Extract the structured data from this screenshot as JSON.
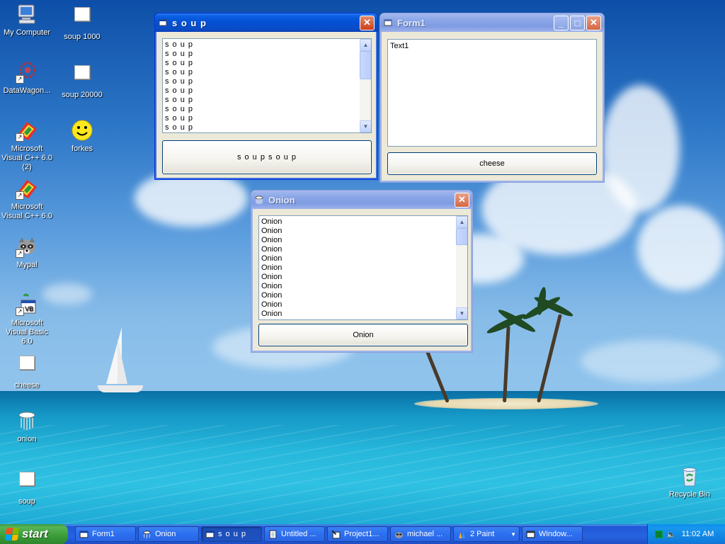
{
  "desktop": {
    "icons": [
      {
        "label": "My Computer",
        "icon": "my-computer-icon"
      },
      {
        "label": "soup 1000",
        "icon": "file-icon"
      },
      {
        "label": "DataWagon...",
        "icon": "datawagon-icon"
      },
      {
        "label": "soup 20000",
        "icon": "file-icon"
      },
      {
        "label": "Microsoft Visual C++ 6.0 (2)",
        "icon": "visual-cpp-icon"
      },
      {
        "label": "forkes",
        "icon": "smiley-icon"
      },
      {
        "label": "Microsoft Visual C++ 6.0",
        "icon": "visual-cpp-icon"
      },
      {
        "label": "Mypal",
        "icon": "raccoon-icon"
      },
      {
        "label": "Microsoft Visual Basic 6.0",
        "icon": "visual-basic-icon"
      },
      {
        "label": "cheese",
        "icon": "file-icon"
      },
      {
        "label": "onion",
        "icon": "onion-icon"
      },
      {
        "label": "soup",
        "icon": "file-icon"
      },
      {
        "label": "Recycle Bin",
        "icon": "recycle-bin-icon"
      }
    ]
  },
  "windows": {
    "soup": {
      "title": "s o u p",
      "list_items": [
        "s o u p",
        "s o u p",
        "s o u p",
        "s o u p",
        "s o u p",
        "s o u p",
        "s o u p",
        "s o u p",
        "s o u p",
        "s o u p"
      ],
      "button_label": "s o u p s o u p"
    },
    "form1": {
      "title": "Form1",
      "textbox_value": "Text1",
      "button_label": "cheese"
    },
    "onion": {
      "title": "Onion",
      "list_items": [
        "Onion",
        "Onion",
        "Onion",
        "Onion",
        "Onion",
        "Onion",
        "Onion",
        "Onion",
        "Onion",
        "Onion",
        "Onion"
      ],
      "button_label": "Onion"
    }
  },
  "taskbar": {
    "start_label": "start",
    "tasks": [
      {
        "label": "Form1",
        "icon": "vb-form-icon"
      },
      {
        "label": "Onion",
        "icon": "onion-icon"
      },
      {
        "label": "s o u p",
        "icon": "vb-form-icon"
      },
      {
        "label": "Untitled ...",
        "icon": "notepad-icon"
      },
      {
        "label": "Project1...",
        "icon": "vb-project-icon"
      },
      {
        "label": "michael ...",
        "icon": "raccoon-icon"
      },
      {
        "label": "2 Paint",
        "icon": "paint-icon"
      },
      {
        "label": "Window...",
        "icon": "window-icon"
      }
    ],
    "clock": "11:02 AM"
  },
  "colors": {
    "title_active": "#0450d4",
    "title_inactive": "#8ea9e8",
    "taskbar": "#2663e0",
    "start_green": "#3a9b37",
    "tray_blue": "#0f80df"
  }
}
